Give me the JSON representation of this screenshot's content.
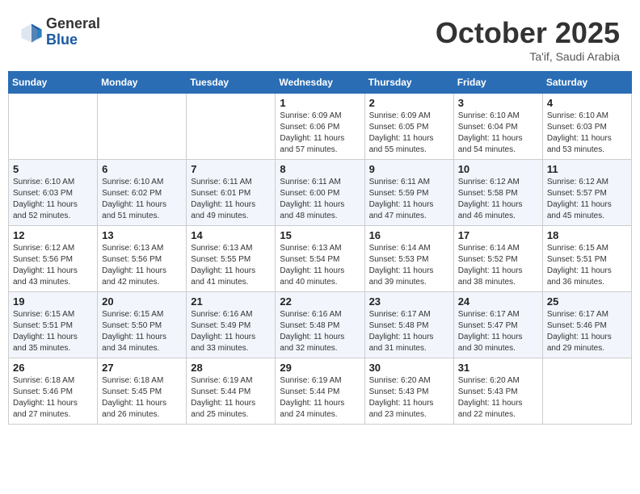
{
  "header": {
    "logo_general": "General",
    "logo_blue": "Blue",
    "title": "October 2025",
    "location": "Ta'if, Saudi Arabia"
  },
  "weekdays": [
    "Sunday",
    "Monday",
    "Tuesday",
    "Wednesday",
    "Thursday",
    "Friday",
    "Saturday"
  ],
  "weeks": [
    [
      {
        "day": "",
        "sunrise": "",
        "sunset": "",
        "daylight": ""
      },
      {
        "day": "",
        "sunrise": "",
        "sunset": "",
        "daylight": ""
      },
      {
        "day": "",
        "sunrise": "",
        "sunset": "",
        "daylight": ""
      },
      {
        "day": "1",
        "sunrise": "Sunrise: 6:09 AM",
        "sunset": "Sunset: 6:06 PM",
        "daylight": "Daylight: 11 hours and 57 minutes."
      },
      {
        "day": "2",
        "sunrise": "Sunrise: 6:09 AM",
        "sunset": "Sunset: 6:05 PM",
        "daylight": "Daylight: 11 hours and 55 minutes."
      },
      {
        "day": "3",
        "sunrise": "Sunrise: 6:10 AM",
        "sunset": "Sunset: 6:04 PM",
        "daylight": "Daylight: 11 hours and 54 minutes."
      },
      {
        "day": "4",
        "sunrise": "Sunrise: 6:10 AM",
        "sunset": "Sunset: 6:03 PM",
        "daylight": "Daylight: 11 hours and 53 minutes."
      }
    ],
    [
      {
        "day": "5",
        "sunrise": "Sunrise: 6:10 AM",
        "sunset": "Sunset: 6:03 PM",
        "daylight": "Daylight: 11 hours and 52 minutes."
      },
      {
        "day": "6",
        "sunrise": "Sunrise: 6:10 AM",
        "sunset": "Sunset: 6:02 PM",
        "daylight": "Daylight: 11 hours and 51 minutes."
      },
      {
        "day": "7",
        "sunrise": "Sunrise: 6:11 AM",
        "sunset": "Sunset: 6:01 PM",
        "daylight": "Daylight: 11 hours and 49 minutes."
      },
      {
        "day": "8",
        "sunrise": "Sunrise: 6:11 AM",
        "sunset": "Sunset: 6:00 PM",
        "daylight": "Daylight: 11 hours and 48 minutes."
      },
      {
        "day": "9",
        "sunrise": "Sunrise: 6:11 AM",
        "sunset": "Sunset: 5:59 PM",
        "daylight": "Daylight: 11 hours and 47 minutes."
      },
      {
        "day": "10",
        "sunrise": "Sunrise: 6:12 AM",
        "sunset": "Sunset: 5:58 PM",
        "daylight": "Daylight: 11 hours and 46 minutes."
      },
      {
        "day": "11",
        "sunrise": "Sunrise: 6:12 AM",
        "sunset": "Sunset: 5:57 PM",
        "daylight": "Daylight: 11 hours and 45 minutes."
      }
    ],
    [
      {
        "day": "12",
        "sunrise": "Sunrise: 6:12 AM",
        "sunset": "Sunset: 5:56 PM",
        "daylight": "Daylight: 11 hours and 43 minutes."
      },
      {
        "day": "13",
        "sunrise": "Sunrise: 6:13 AM",
        "sunset": "Sunset: 5:56 PM",
        "daylight": "Daylight: 11 hours and 42 minutes."
      },
      {
        "day": "14",
        "sunrise": "Sunrise: 6:13 AM",
        "sunset": "Sunset: 5:55 PM",
        "daylight": "Daylight: 11 hours and 41 minutes."
      },
      {
        "day": "15",
        "sunrise": "Sunrise: 6:13 AM",
        "sunset": "Sunset: 5:54 PM",
        "daylight": "Daylight: 11 hours and 40 minutes."
      },
      {
        "day": "16",
        "sunrise": "Sunrise: 6:14 AM",
        "sunset": "Sunset: 5:53 PM",
        "daylight": "Daylight: 11 hours and 39 minutes."
      },
      {
        "day": "17",
        "sunrise": "Sunrise: 6:14 AM",
        "sunset": "Sunset: 5:52 PM",
        "daylight": "Daylight: 11 hours and 38 minutes."
      },
      {
        "day": "18",
        "sunrise": "Sunrise: 6:15 AM",
        "sunset": "Sunset: 5:51 PM",
        "daylight": "Daylight: 11 hours and 36 minutes."
      }
    ],
    [
      {
        "day": "19",
        "sunrise": "Sunrise: 6:15 AM",
        "sunset": "Sunset: 5:51 PM",
        "daylight": "Daylight: 11 hours and 35 minutes."
      },
      {
        "day": "20",
        "sunrise": "Sunrise: 6:15 AM",
        "sunset": "Sunset: 5:50 PM",
        "daylight": "Daylight: 11 hours and 34 minutes."
      },
      {
        "day": "21",
        "sunrise": "Sunrise: 6:16 AM",
        "sunset": "Sunset: 5:49 PM",
        "daylight": "Daylight: 11 hours and 33 minutes."
      },
      {
        "day": "22",
        "sunrise": "Sunrise: 6:16 AM",
        "sunset": "Sunset: 5:48 PM",
        "daylight": "Daylight: 11 hours and 32 minutes."
      },
      {
        "day": "23",
        "sunrise": "Sunrise: 6:17 AM",
        "sunset": "Sunset: 5:48 PM",
        "daylight": "Daylight: 11 hours and 31 minutes."
      },
      {
        "day": "24",
        "sunrise": "Sunrise: 6:17 AM",
        "sunset": "Sunset: 5:47 PM",
        "daylight": "Daylight: 11 hours and 30 minutes."
      },
      {
        "day": "25",
        "sunrise": "Sunrise: 6:17 AM",
        "sunset": "Sunset: 5:46 PM",
        "daylight": "Daylight: 11 hours and 29 minutes."
      }
    ],
    [
      {
        "day": "26",
        "sunrise": "Sunrise: 6:18 AM",
        "sunset": "Sunset: 5:46 PM",
        "daylight": "Daylight: 11 hours and 27 minutes."
      },
      {
        "day": "27",
        "sunrise": "Sunrise: 6:18 AM",
        "sunset": "Sunset: 5:45 PM",
        "daylight": "Daylight: 11 hours and 26 minutes."
      },
      {
        "day": "28",
        "sunrise": "Sunrise: 6:19 AM",
        "sunset": "Sunset: 5:44 PM",
        "daylight": "Daylight: 11 hours and 25 minutes."
      },
      {
        "day": "29",
        "sunrise": "Sunrise: 6:19 AM",
        "sunset": "Sunset: 5:44 PM",
        "daylight": "Daylight: 11 hours and 24 minutes."
      },
      {
        "day": "30",
        "sunrise": "Sunrise: 6:20 AM",
        "sunset": "Sunset: 5:43 PM",
        "daylight": "Daylight: 11 hours and 23 minutes."
      },
      {
        "day": "31",
        "sunrise": "Sunrise: 6:20 AM",
        "sunset": "Sunset: 5:43 PM",
        "daylight": "Daylight: 11 hours and 22 minutes."
      },
      {
        "day": "",
        "sunrise": "",
        "sunset": "",
        "daylight": ""
      }
    ]
  ]
}
